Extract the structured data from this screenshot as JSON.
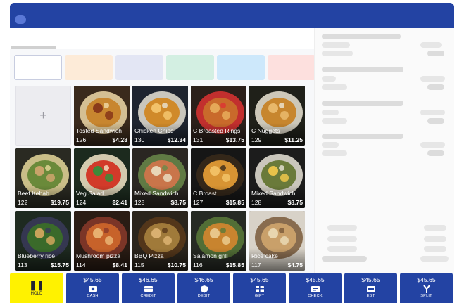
{
  "categories": [
    {
      "color": "#ffffff",
      "selected": true
    },
    {
      "color": "#fdebd8"
    },
    {
      "color": "#e3e6f4"
    },
    {
      "color": "#d3efe2"
    },
    {
      "color": "#cde8fb"
    },
    {
      "color": "#fde0de"
    }
  ],
  "add_tile": {
    "symbol": "+"
  },
  "items": [
    {
      "name": "Tosted Sandwich",
      "sku": "126",
      "price": "$4.28"
    },
    {
      "name": "Chicken Chips",
      "sku": "130",
      "price": "$12.34"
    },
    {
      "name": "C Broasted Rings",
      "sku": "131",
      "price": "$13.75"
    },
    {
      "name": "C Nuggets",
      "sku": "129",
      "price": "$11.25"
    },
    {
      "name": "Beef Kebab",
      "sku": "122",
      "price": "$19.75"
    },
    {
      "name": "Veg Salad",
      "sku": "124",
      "price": "$2.41"
    },
    {
      "name": "Mixed Sandwich",
      "sku": "128",
      "price": "$8.75"
    },
    {
      "name": "C Broast",
      "sku": "127",
      "price": "$15.85"
    },
    {
      "name": "Mixed Sandwich",
      "sku": "128",
      "price": "$8.75"
    },
    {
      "name": "Blueberry rice",
      "sku": "113",
      "price": "$15.75"
    },
    {
      "name": "Mushroom pizza",
      "sku": "114",
      "price": "$8.41"
    },
    {
      "name": "BBQ Pizza",
      "sku": "115",
      "price": "$10.75"
    },
    {
      "name": "Salamon grill",
      "sku": "116",
      "price": "$15.85"
    },
    {
      "name": "Rice cake",
      "sku": "117",
      "price": "$4.75"
    }
  ],
  "hold": {
    "label": "HOLD",
    "icon": "pause-icon"
  },
  "payments": [
    {
      "amount": "$45.65",
      "label": "CASH",
      "icon": "cash-icon"
    },
    {
      "amount": "$46.65",
      "label": "CREDIT",
      "icon": "credit-card-icon"
    },
    {
      "amount": "$46.65",
      "label": "DEBIT",
      "icon": "debit-shield-icon"
    },
    {
      "amount": "$45.65",
      "label": "GIFT",
      "icon": "gift-card-icon"
    },
    {
      "amount": "$45.65",
      "label": "CHECK",
      "icon": "check-icon"
    },
    {
      "amount": "$45.65",
      "label": "EBT",
      "icon": "ebt-card-icon"
    },
    {
      "amount": "$45.65",
      "label": "SPLIT",
      "icon": "split-icon"
    }
  ],
  "colors": {
    "brand": "#2343a3",
    "hold": "#fff200"
  }
}
